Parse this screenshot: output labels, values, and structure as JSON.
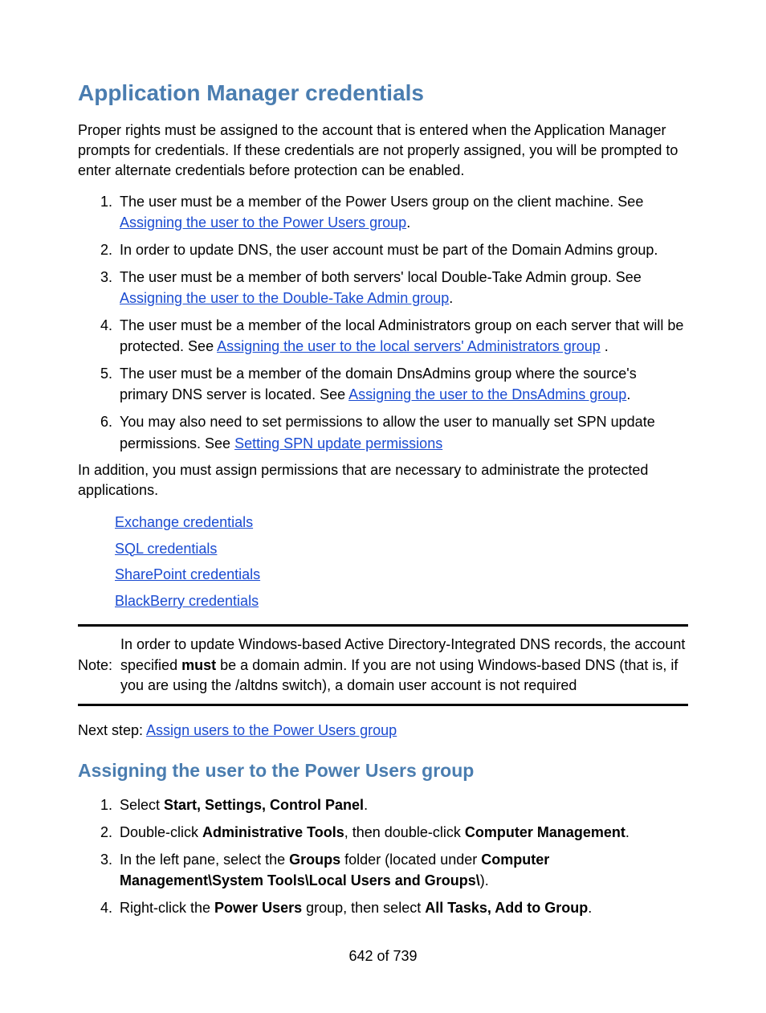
{
  "title": "Application Manager credentials",
  "intro": "Proper rights must be assigned to the account that is entered when the Application Manager prompts for credentials. If these credentials are not properly assigned, you will be prompted to enter alternate credentials before protection can be enabled.",
  "list1": {
    "item1_pre": "The user must be a member of the Power Users group on the client machine. See ",
    "item1_link": "Assigning the user to the Power Users group",
    "item1_post": ".",
    "item2": "In order to update DNS, the user account must be part of the Domain Admins group.",
    "item3_pre": "The user must be a member of both servers' local Double-Take Admin group. See ",
    "item3_link": "Assigning the user to the Double-Take Admin group",
    "item3_post": ".",
    "item4_pre": "The user must be a member of the local Administrators group on each server that will be protected. See ",
    "item4_link": "Assigning the user to the local servers' Administrators group",
    "item4_post": " .",
    "item5_pre": "The user must be a member of the domain DnsAdmins group where the source's primary DNS server is located. See ",
    "item5_link": "Assigning the user to the DnsAdmins group",
    "item5_post": ".",
    "item6_pre": "You may also need to set permissions to allow the user to manually set SPN update permissions. See ",
    "item6_link": "Setting SPN update permissions"
  },
  "mid_para": "In addition, you must assign permissions that are necessary to administrate the protected applications.",
  "cred_links": {
    "a": "Exchange credentials",
    "b": "SQL credentials",
    "c": "SharePoint credentials",
    "d": "BlackBerry credentials"
  },
  "note": {
    "label": "Note:",
    "text_pre": "In order to update Windows-based Active Directory-Integrated DNS records, the account specified ",
    "must": "must",
    "text_post": " be a domain admin. If you are not using Windows-based DNS (that is, if you are using the /altdns switch), a domain user account is not required"
  },
  "next_step_label": "Next step: ",
  "next_step_link": "Assign users to the Power Users group",
  "h2": "Assigning the user to the Power Users group",
  "list2": {
    "i1_pre": "Select ",
    "i1_b": "Start, Settings, Control Panel",
    "i1_post": ".",
    "i2_pre": "Double-click ",
    "i2_b1": "Administrative Tools",
    "i2_mid": ", then double-click ",
    "i2_b2": "Computer Management",
    "i2_post": ".",
    "i3_pre": "In the left pane, select the ",
    "i3_b1": "Groups",
    "i3_mid": " folder (located under ",
    "i3_b2": "Computer Management\\System Tools\\Local Users and Groups\\",
    "i3_post": ").",
    "i4_pre": "Right-click the ",
    "i4_b1": "Power Users",
    "i4_mid": " group, then select ",
    "i4_b2": "All Tasks, Add to Group",
    "i4_post": "."
  },
  "footer": "642 of 739"
}
